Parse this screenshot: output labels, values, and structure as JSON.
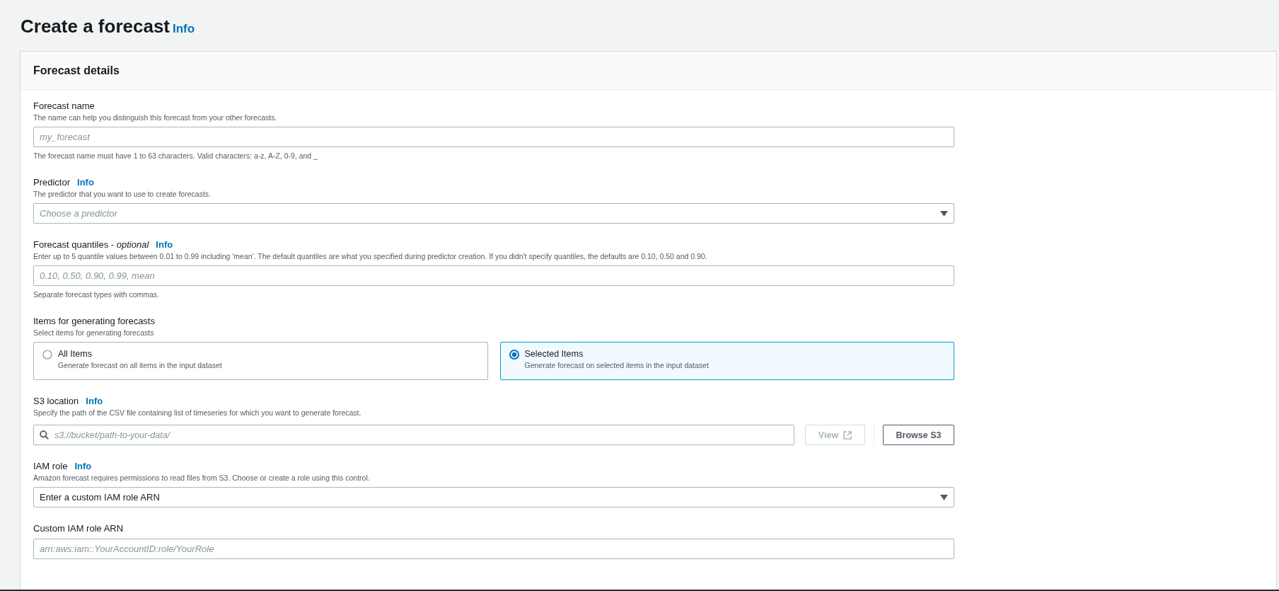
{
  "page": {
    "title": "Create a forecast",
    "info_link": "Info"
  },
  "panel": {
    "title": "Forecast details",
    "fields": [
      {
        "kind": "text",
        "label": "Forecast name",
        "description": "The name can help you distinguish this forecast from your other forecasts.",
        "placeholder": "my_forecast",
        "constraint": "The forecast name must have 1 to 63 characters. Valid characters: a-z, A-Z, 0-9, and _"
      },
      {
        "kind": "select",
        "label": "Predictor",
        "info_link": "Info",
        "description": "The predictor that you want to use to create forecasts.",
        "placeholder": "Choose a predictor"
      },
      {
        "kind": "text",
        "label": "Forecast quantiles - *optional*",
        "info_link": "Info",
        "description": "Enter up to 5 quantile values between 0.01 to 0.99 including 'mean'. The default quantiles are what you specified during predictor creation. If you didn't specify quantiles, the defaults are 0.10, 0.50 and 0.90.",
        "placeholder": "0.10, 0.50, 0.90, 0.99, mean",
        "constraint": "Separate forecast types with commas."
      },
      {
        "kind": "tiles",
        "label": "Items for generating forecasts",
        "description": "Select items for generating forecasts",
        "options": [
          {
            "label": "All Items",
            "description": "Generate forecast on all items in the input dataset",
            "selected": false
          },
          {
            "label": "Selected Items",
            "description": "Generate forecast on selected items in the input dataset",
            "selected": true
          }
        ]
      },
      {
        "kind": "s3",
        "label": "S3 location",
        "info_link": "Info",
        "description": "Specify the path of the CSV file containing list of timeseries for which you want to generate forecast.",
        "placeholder": "s3://bucket/path-to-your-data/",
        "view_button": "View",
        "browse_button": "Browse S3"
      },
      {
        "kind": "select",
        "label": "IAM role",
        "info_link": "Info",
        "description": "Amazon forecast requires permissions to read files from S3. Choose or create a role using this control.",
        "value": "Enter a custom IAM role ARN"
      },
      {
        "kind": "text",
        "label": "Custom IAM role ARN",
        "placeholder": "arn:aws:iam::YourAccountID:role/YourRole"
      }
    ]
  }
}
